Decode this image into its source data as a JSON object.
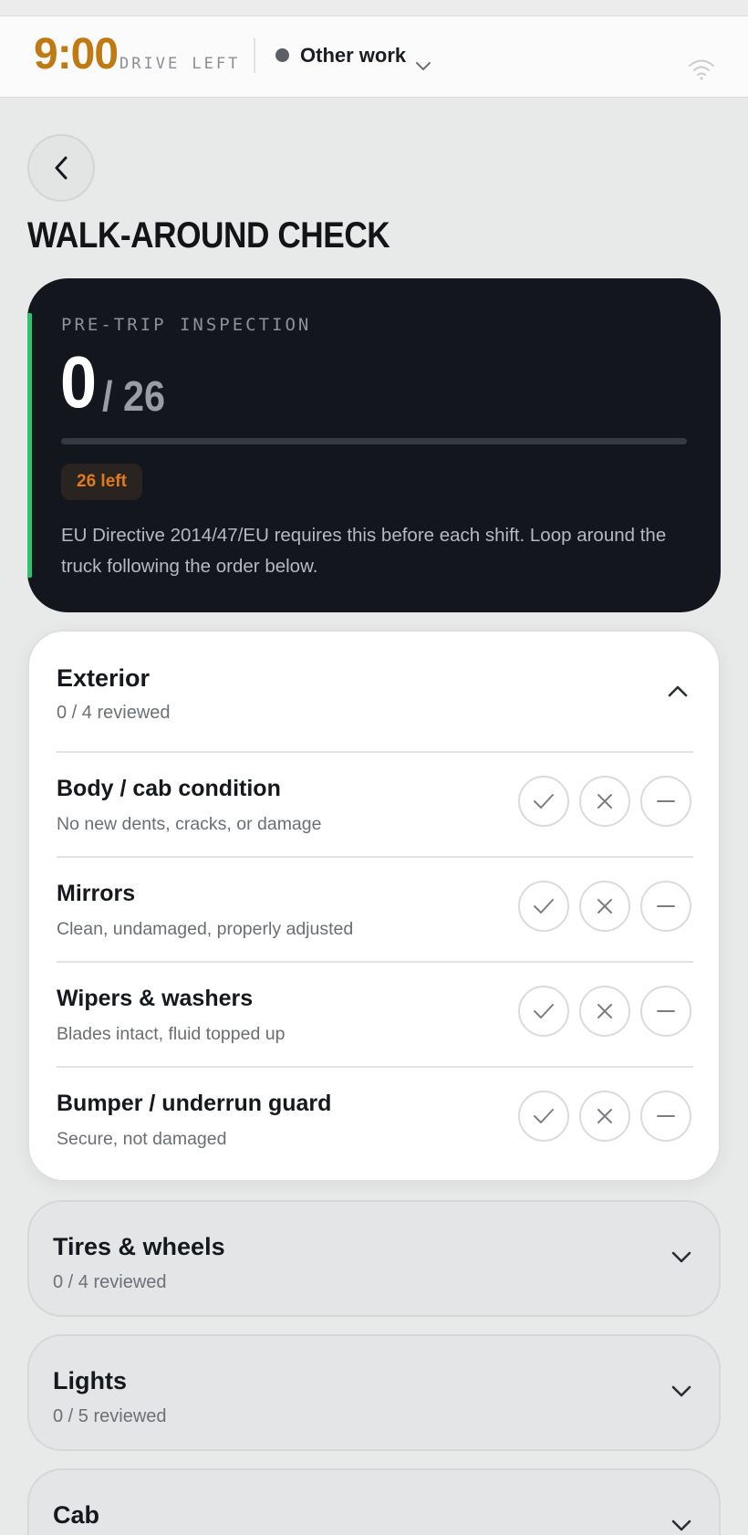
{
  "topbar": {
    "drive_time": "9:00",
    "drive_label": "DRIVE LEFT",
    "status": "Other work",
    "status_color": "#5a5f66",
    "accent_color": "#c07a12"
  },
  "page": {
    "title": "WALK-AROUND CHECK",
    "back_icon": "chevron-left-icon"
  },
  "summary": {
    "label": "PRE-TRIP INSPECTION",
    "count": "0",
    "total": "/ 26",
    "progress_fraction": 0,
    "left_badge": "26 left",
    "note": "EU Directive 2014/47/EU requires this before each shift. Loop around the truck following the order below.",
    "accent_color": "#2fc36b"
  },
  "sections": [
    {
      "title": "Exterior",
      "sub": "0 / 4 reviewed",
      "expanded": true,
      "items": [
        {
          "title": "Body / cab condition",
          "sub": "No new dents, cracks, or damage"
        },
        {
          "title": "Mirrors",
          "sub": "Clean, undamaged, properly adjusted"
        },
        {
          "title": "Wipers & washers",
          "sub": "Blades intact, fluid topped up"
        },
        {
          "title": "Bumper / underrun guard",
          "sub": "Secure, not damaged"
        }
      ]
    },
    {
      "title": "Tires & wheels",
      "sub": "0 / 4 reviewed",
      "expanded": false
    },
    {
      "title": "Lights",
      "sub": "0 / 5 reviewed",
      "expanded": false
    },
    {
      "title": "Cab",
      "sub": "",
      "expanded": false
    }
  ],
  "choice_icons": [
    "check-icon",
    "x-icon",
    "minus-icon"
  ]
}
